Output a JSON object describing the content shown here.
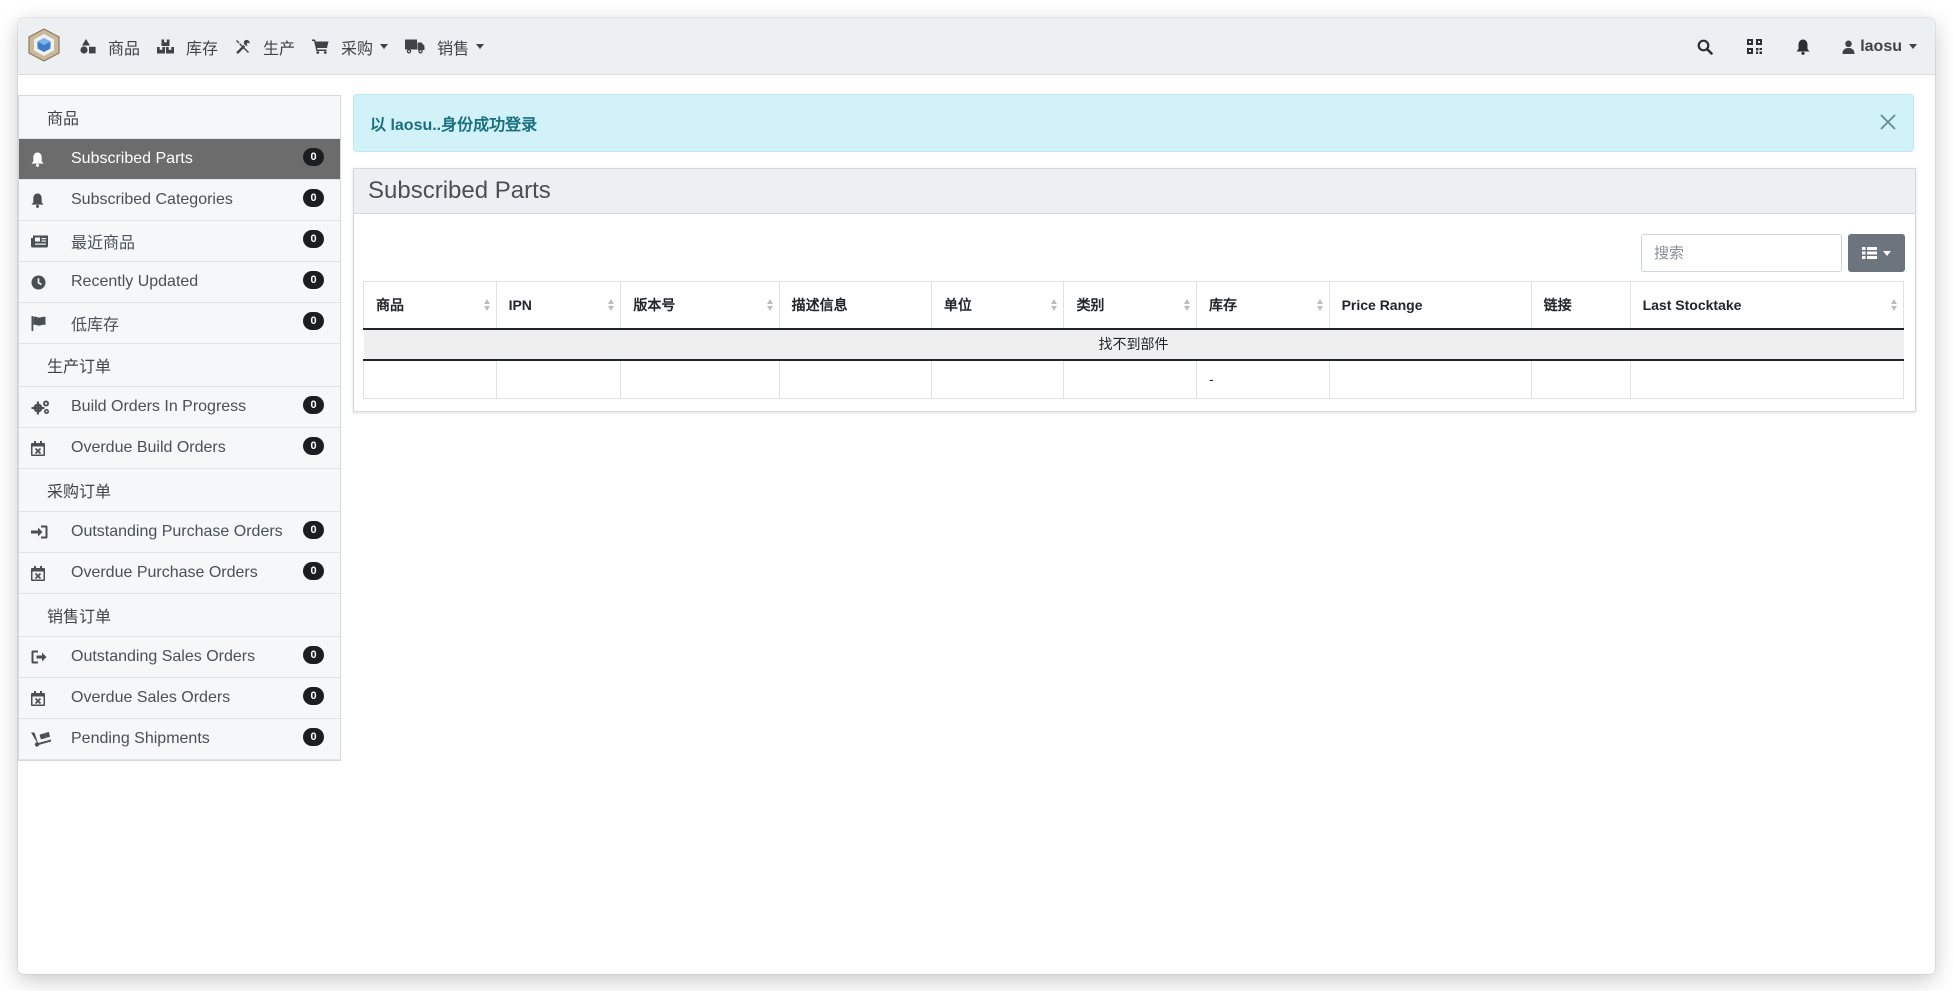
{
  "navbar": {
    "items": [
      {
        "label": "商品",
        "icon": "shapes-icon",
        "dropdown": false
      },
      {
        "label": "库存",
        "icon": "boxes-icon",
        "dropdown": false
      },
      {
        "label": "生产",
        "icon": "tools-icon",
        "dropdown": false
      },
      {
        "label": "采购",
        "icon": "shopping-cart-icon",
        "dropdown": true
      },
      {
        "label": "销售",
        "icon": "truck-icon",
        "dropdown": true
      }
    ],
    "user": "laosu"
  },
  "sidebar": {
    "sections": [
      {
        "header": "商品",
        "items": [
          {
            "label": "Subscribed Parts",
            "icon": "bell-icon",
            "count": "0",
            "active": true
          },
          {
            "label": "Subscribed Categories",
            "icon": "bell-icon",
            "count": "0",
            "active": false
          },
          {
            "label": "最近商品",
            "icon": "newspaper-icon",
            "count": "0",
            "active": false
          },
          {
            "label": "Recently Updated",
            "icon": "clock-icon",
            "count": "0",
            "active": false
          },
          {
            "label": "低库存",
            "icon": "flag-icon",
            "count": "0",
            "active": false
          }
        ]
      },
      {
        "header": "生产订单",
        "items": [
          {
            "label": "Build Orders In Progress",
            "icon": "cogs-icon",
            "count": "0",
            "active": false
          },
          {
            "label": "Overdue Build Orders",
            "icon": "calendar-times-icon",
            "count": "0",
            "active": false
          }
        ]
      },
      {
        "header": "采购订单",
        "items": [
          {
            "label": "Outstanding Purchase Orders",
            "icon": "sign-in-icon",
            "count": "0",
            "active": false
          },
          {
            "label": "Overdue Purchase Orders",
            "icon": "calendar-times-icon",
            "count": "0",
            "active": false
          }
        ]
      },
      {
        "header": "销售订单",
        "items": [
          {
            "label": "Outstanding Sales Orders",
            "icon": "sign-out-icon",
            "count": "0",
            "active": false
          },
          {
            "label": "Overdue Sales Orders",
            "icon": "calendar-times-icon",
            "count": "0",
            "active": false
          },
          {
            "label": "Pending Shipments",
            "icon": "dolly-icon",
            "count": "0",
            "active": false
          }
        ]
      }
    ]
  },
  "alert": {
    "message": "以 laosu..身份成功登录"
  },
  "panel": {
    "title": "Subscribed Parts",
    "search_placeholder": "搜索",
    "columns": [
      {
        "label": "商品",
        "sortable": true
      },
      {
        "label": "IPN",
        "sortable": true
      },
      {
        "label": "版本号",
        "sortable": true
      },
      {
        "label": "描述信息",
        "sortable": false
      },
      {
        "label": "单位",
        "sortable": true
      },
      {
        "label": "类别",
        "sortable": true
      },
      {
        "label": "库存",
        "sortable": true
      },
      {
        "label": "Price Range",
        "sortable": false
      },
      {
        "label": "链接",
        "sortable": false
      },
      {
        "label": "Last Stocktake",
        "sortable": true
      }
    ],
    "empty_message": "找不到部件",
    "footer": [
      "",
      "",
      "",
      "",
      "",
      "",
      "-",
      "",
      "",
      ""
    ]
  },
  "colors": {
    "active_bg": "#6c6c6c",
    "alert_bg": "#d1f2f8",
    "alert_text": "#1a6f7f",
    "badge": "#1b1e21"
  }
}
